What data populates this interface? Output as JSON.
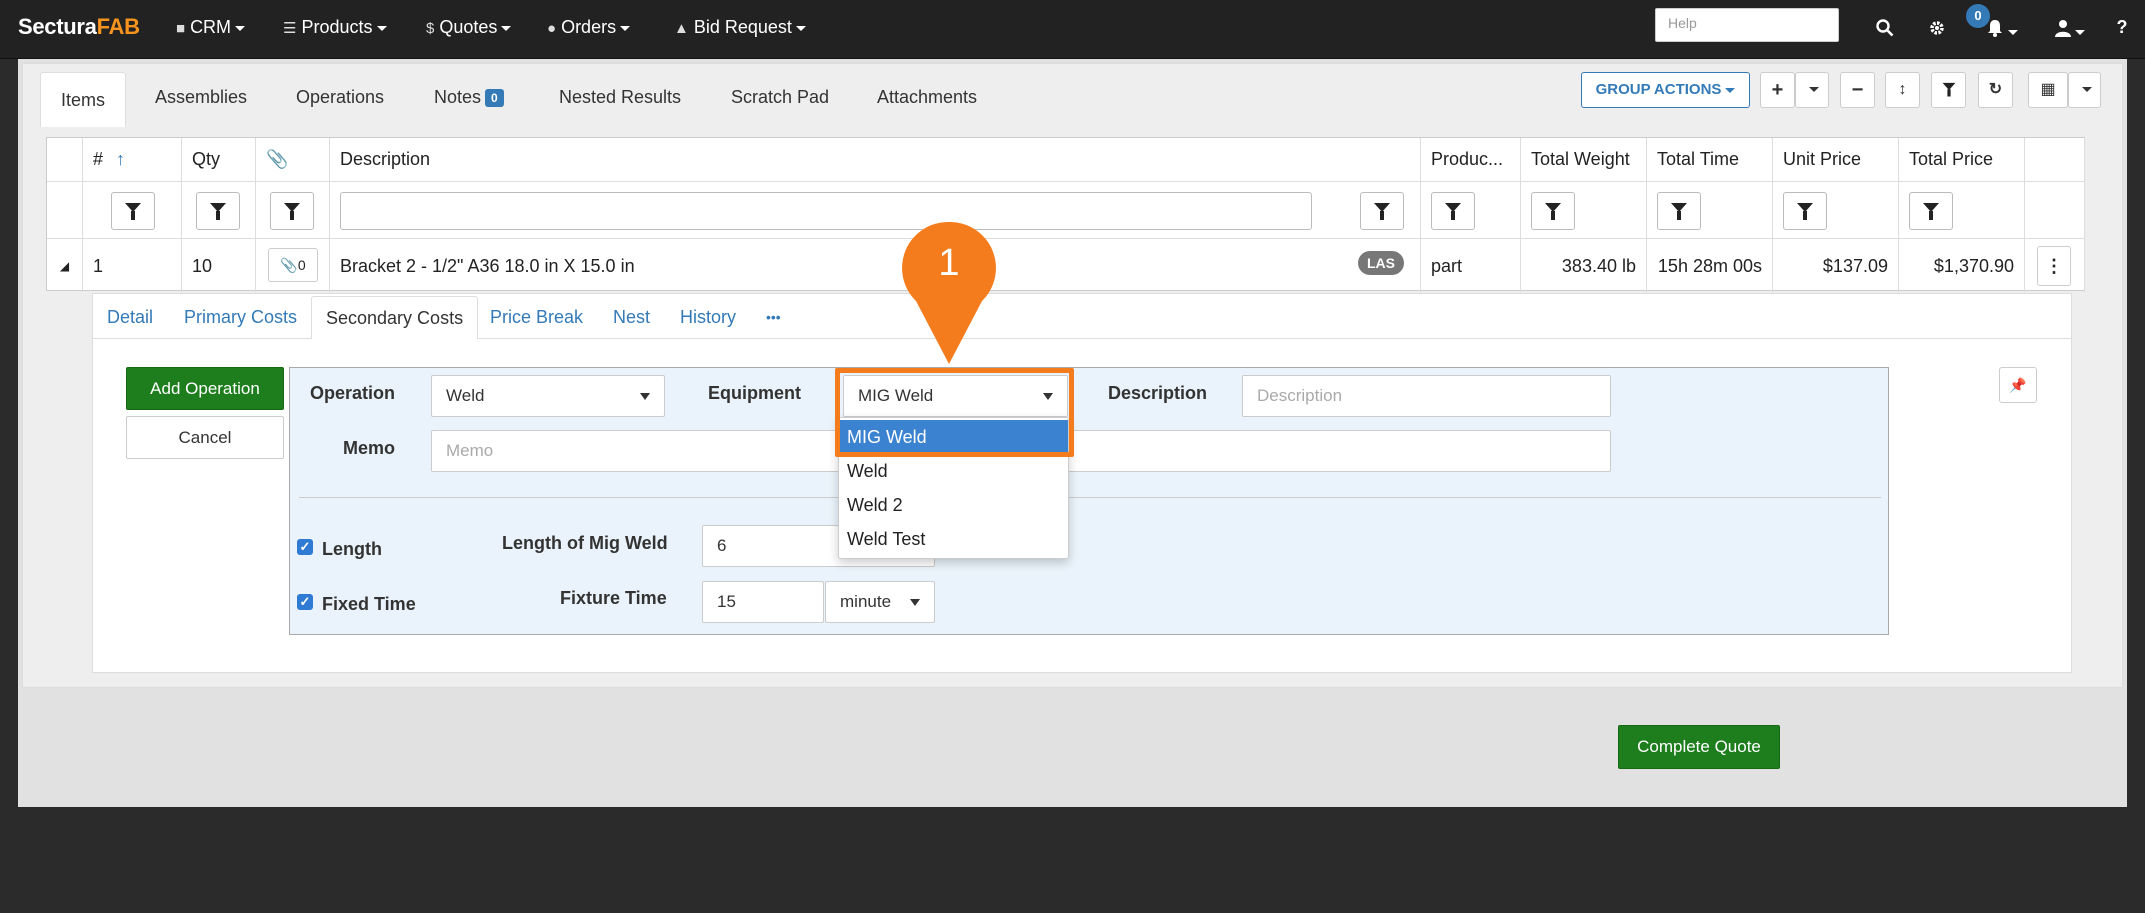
{
  "navbar": {
    "brand_prefix": "Sectura",
    "brand_suffix": "FAB",
    "menu": [
      {
        "label": "CRM",
        "icon": "user-icon"
      },
      {
        "label": "Products",
        "icon": "barcode-icon"
      },
      {
        "label": "Quotes",
        "icon": "dollar-icon"
      },
      {
        "label": "Orders",
        "icon": "bell-icon"
      },
      {
        "label": "Bid Request",
        "icon": "gavel-icon"
      }
    ],
    "help_placeholder": "Help",
    "notification_count": "0"
  },
  "tabs": [
    {
      "label": "Items",
      "active": true
    },
    {
      "label": "Assemblies"
    },
    {
      "label": "Operations"
    },
    {
      "label": "Notes",
      "badge": "0"
    },
    {
      "label": "Nested Results"
    },
    {
      "label": "Scratch Pad"
    },
    {
      "label": "Attachments"
    }
  ],
  "toolbar": {
    "group_actions_label": "GROUP ACTIONS"
  },
  "grid": {
    "columns": [
      "#",
      "Qty",
      "",
      "Description",
      "Produc...",
      "Total Weight",
      "Total Time",
      "Unit Price",
      "Total Price"
    ],
    "row": {
      "num": "1",
      "qty": "10",
      "attach_count": "0",
      "description": "Bracket 2 - 1/2\" A36 18.0 in X 15.0 in",
      "tag": "LAS",
      "product": "part",
      "total_weight": "383.40 lb",
      "total_time": "15h 28m 00s",
      "unit_price": "$137.09",
      "total_price": "$1,370.90"
    }
  },
  "subtabs": [
    "Detail",
    "Primary Costs",
    "Secondary Costs",
    "Price Break",
    "Nest",
    "History",
    "•••"
  ],
  "form": {
    "add_operation_label": "Add Operation",
    "cancel_label": "Cancel",
    "operation_label": "Operation",
    "operation_value": "Weld",
    "equipment_label": "Equipment",
    "equipment_value": "MIG Weld",
    "description_label": "Description",
    "description_placeholder": "Description",
    "memo_label": "Memo",
    "memo_placeholder": "Memo",
    "length_check_label": "Length",
    "length_field_label": "Length of Mig Weld",
    "length_value": "6",
    "fixed_time_check_label": "Fixed Time",
    "fixture_time_label": "Fixture Time",
    "fixture_time_value": "15",
    "fixture_unit": "minute"
  },
  "equipment_dropdown": [
    "MIG Weld",
    "Weld",
    "Weld 2",
    "Weld Test"
  ],
  "callout_number": "1",
  "complete_quote_label": "Complete Quote",
  "colors": {
    "accent_orange": "#f47c1c",
    "primary_blue": "#337ab7",
    "green": "#1e7e1e"
  }
}
